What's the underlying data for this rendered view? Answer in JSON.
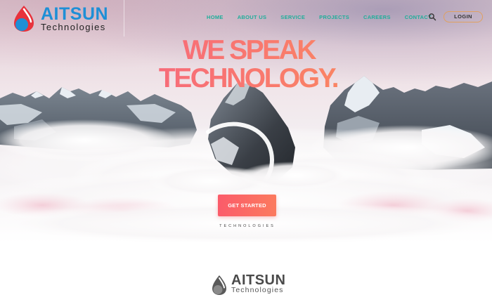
{
  "brand": {
    "name": "AITSUN",
    "sub": "Technologies"
  },
  "nav": {
    "items": [
      {
        "label": "HOME"
      },
      {
        "label": "ABOUT US"
      },
      {
        "label": "SERVICE"
      },
      {
        "label": "PROJECTS"
      },
      {
        "label": "CAREERS"
      },
      {
        "label": "CONTACT"
      }
    ],
    "search_icon": "search-icon",
    "login_label": "LOGIN"
  },
  "hero": {
    "headline_line1": "WE SPEAK",
    "headline_line2": "TECHNOLOGY.",
    "cta_label": "GET STARTED",
    "tagline": "TECHNOLOGIES",
    "background": "snowy-mountains-clouds-image"
  },
  "footer": {
    "brand_name": "AITSUN",
    "brand_sub": "Technologies"
  },
  "colors": {
    "nav_link": "#1fae9a",
    "brand_blue": "#1e8fd6",
    "brand_red": "#e8323c",
    "headline_gradient_start": "#f4588a",
    "headline_gradient_end": "#fb9a4e",
    "cta": "#fb6a64"
  }
}
